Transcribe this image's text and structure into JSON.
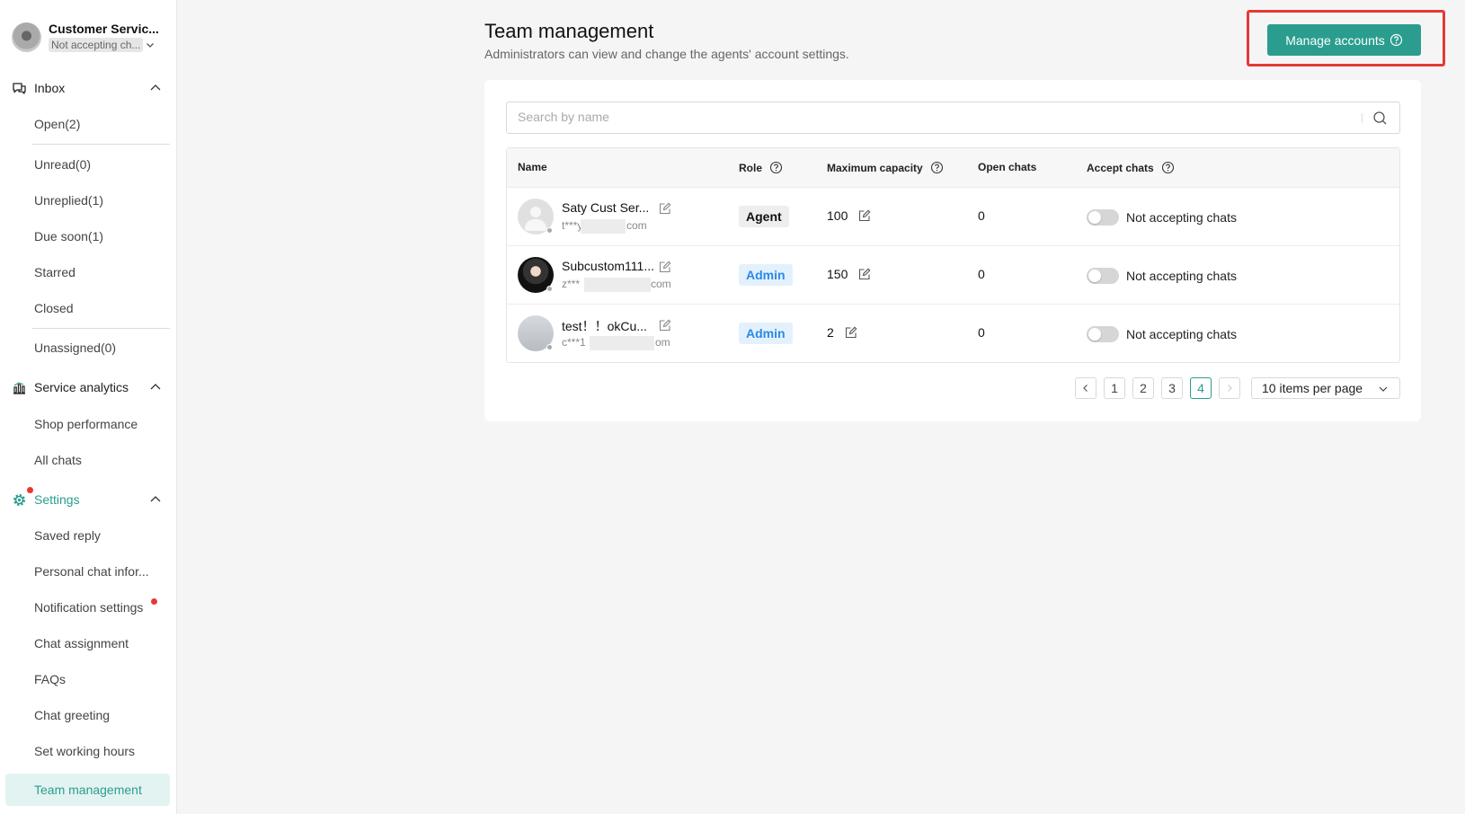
{
  "colors": {
    "accent": "#2a9d8f",
    "admin_blue": "#2b8ae4",
    "alert_red": "#e53935"
  },
  "profile": {
    "name": "Customer Servic...",
    "status": "Not accepting ch..."
  },
  "sidebar": {
    "inbox": {
      "label": "Inbox",
      "icon": "chat-bubbles-icon",
      "items": [
        "Open(2)",
        "Unread(0)",
        "Unreplied(1)",
        "Due soon(1)",
        "Starred",
        "Closed",
        "Unassigned(0)"
      ]
    },
    "analytics": {
      "label": "Service analytics",
      "icon": "bar-chart-icon",
      "items": [
        "Shop performance",
        "All chats"
      ]
    },
    "settings": {
      "label": "Settings",
      "icon": "gear-icon",
      "items": [
        "Saved reply",
        "Personal chat infor...",
        "Notification settings",
        "Chat assignment",
        "FAQs",
        "Chat greeting",
        "Set working hours",
        "Team management"
      ],
      "active": "Team management"
    }
  },
  "page": {
    "title": "Team management",
    "subtitle": "Administrators can view and change the agents' account settings.",
    "manage_button": "Manage accounts"
  },
  "search": {
    "placeholder": "Search by name"
  },
  "table": {
    "columns": [
      "Name",
      "Role",
      "Maximum capacity",
      "Open chats",
      "Accept chats"
    ],
    "rows": [
      {
        "name": "Saty Cust Ser...",
        "email": "t***y",
        "email_end": "com",
        "role": "Agent",
        "capacity": "100",
        "open_chats": "0",
        "accept_label": "Not accepting chats",
        "accepting": false
      },
      {
        "name": "Subcustom111...",
        "email": "z***",
        "email_end": "com",
        "role": "Admin",
        "capacity": "150",
        "open_chats": "0",
        "accept_label": "Not accepting chats",
        "accepting": false
      },
      {
        "name": "test！！okCu...",
        "email": "c***1",
        "email_end": "om",
        "role": "Admin",
        "capacity": "2",
        "open_chats": "0",
        "accept_label": "Not accepting chats",
        "accepting": false
      }
    ]
  },
  "pagination": {
    "pages": [
      "1",
      "2",
      "3",
      "4"
    ],
    "current": "4",
    "page_size": "10 items per page"
  }
}
